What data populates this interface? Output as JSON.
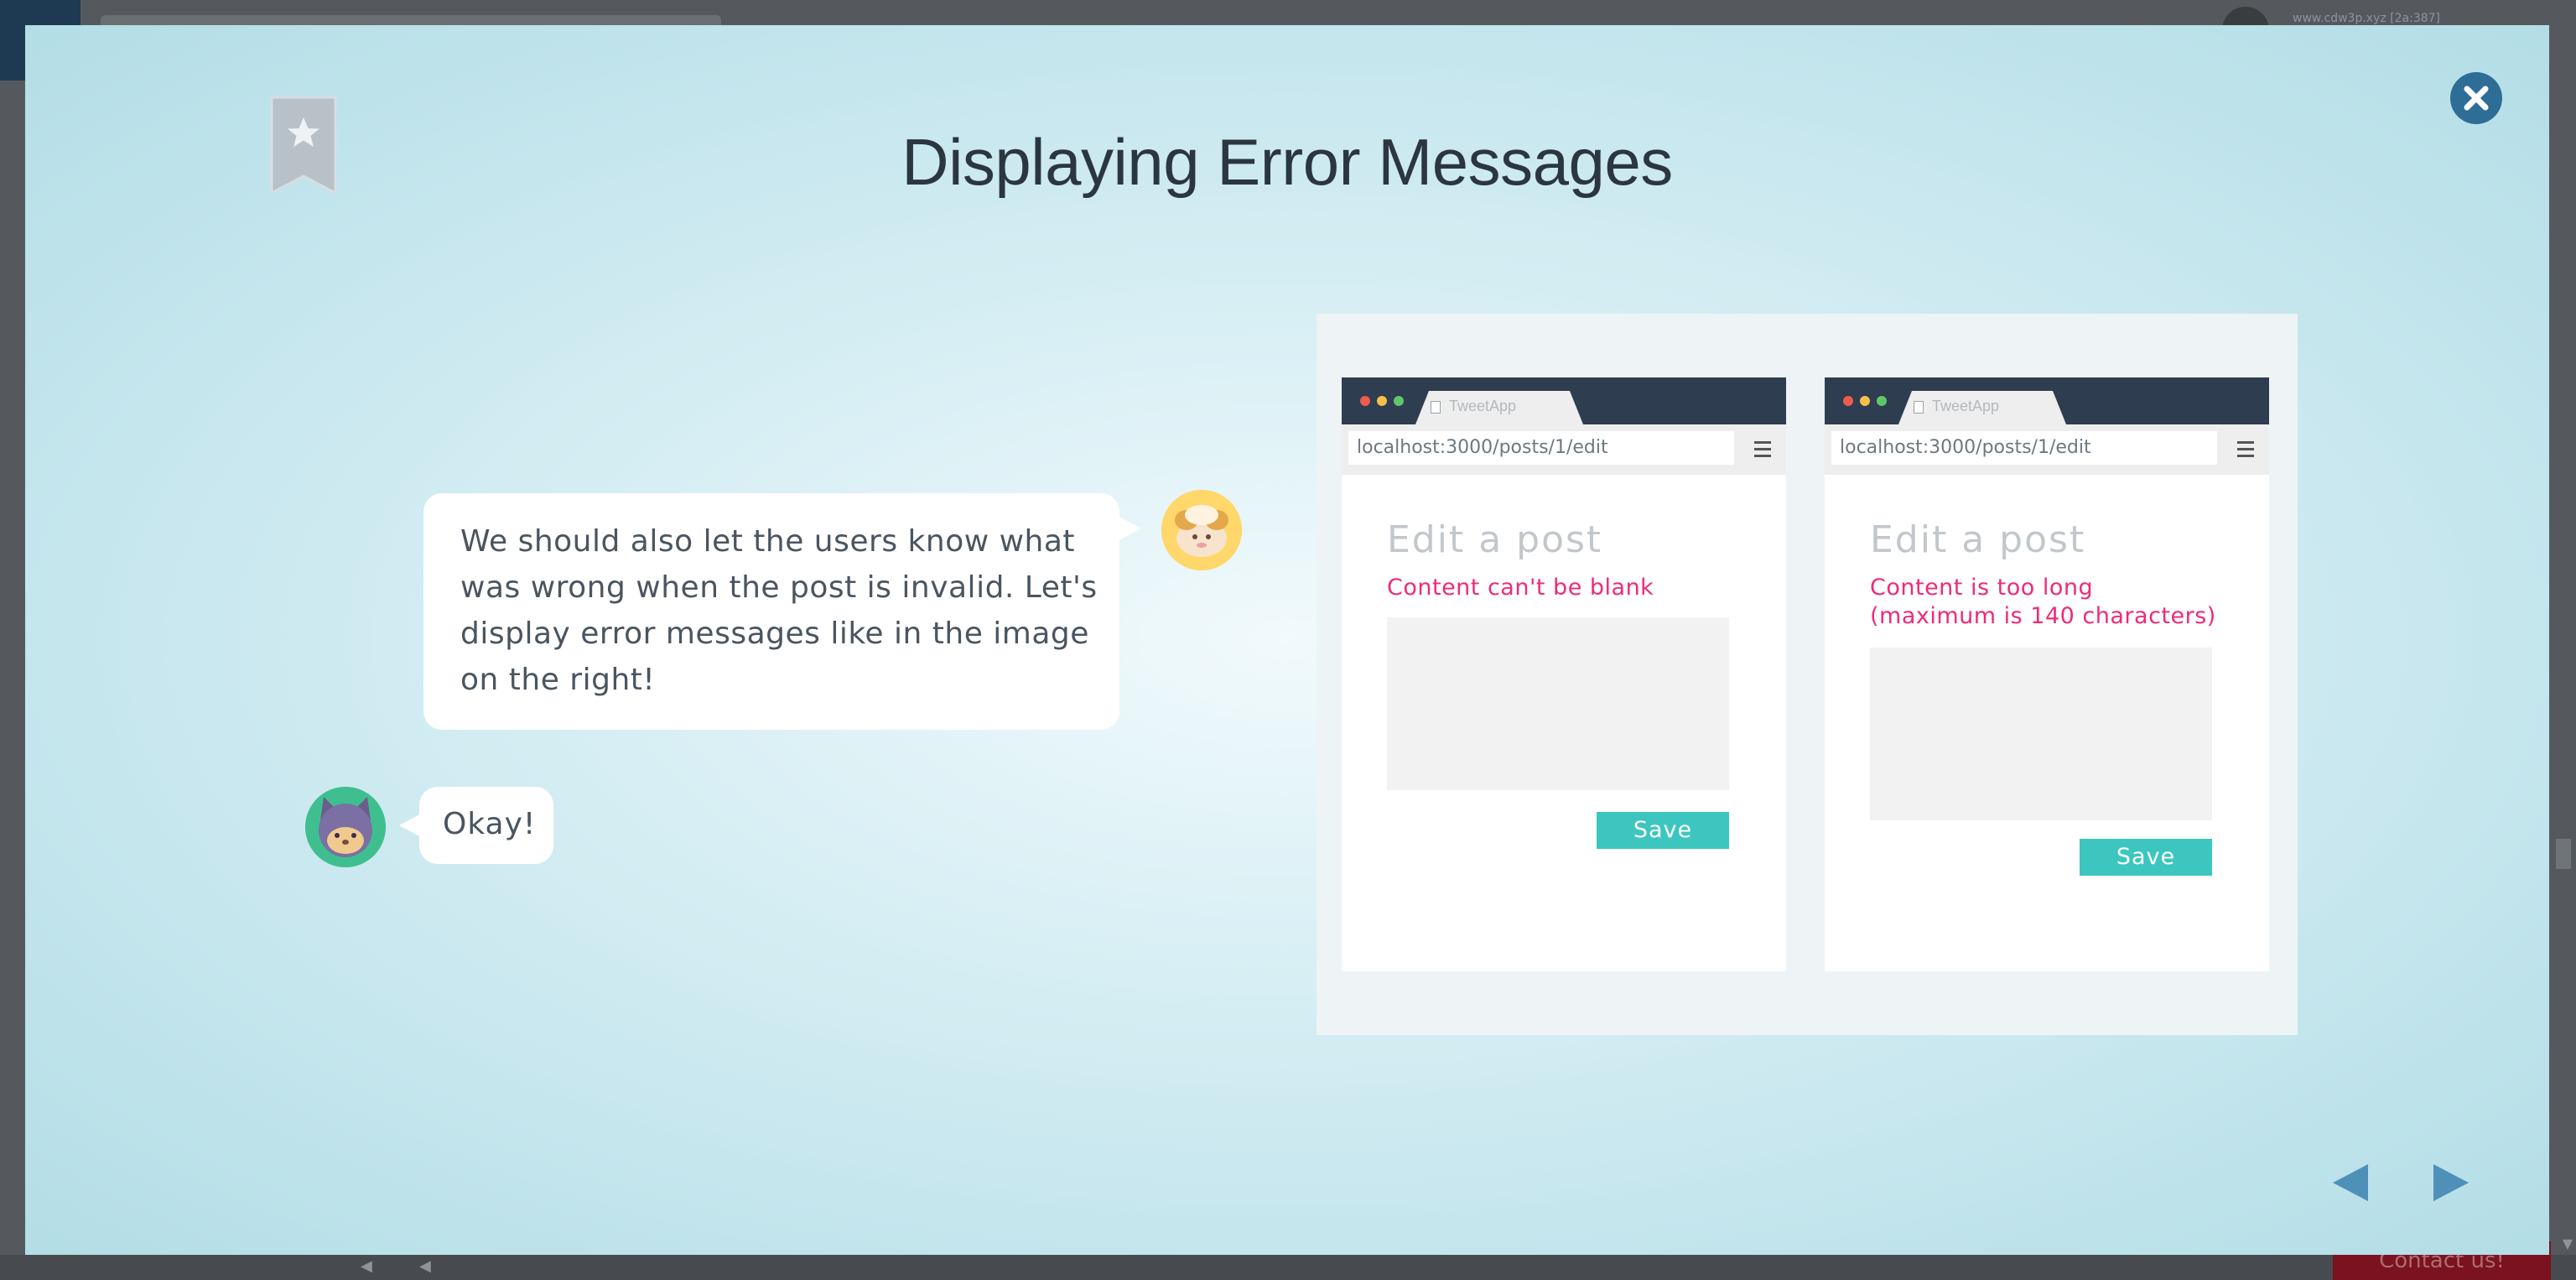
{
  "backdrop": {
    "user_text": "www.cdw3p.xyz [2a:387]",
    "contact_label": "Contact us!"
  },
  "modal": {
    "title": "Displaying Error Messages"
  },
  "dialogue": {
    "message_1": "We should also let the users know what was wrong when the post is invalid. Let's display error messages like in the image on the right!",
    "message_2": "Okay!"
  },
  "illustration": {
    "left_browser": {
      "tab_label": "TweetApp",
      "address": "localhost:3000/posts/1/edit",
      "heading": "Edit a post",
      "error": "Content can't be blank",
      "save_label": "Save"
    },
    "right_browser": {
      "tab_label": "TweetApp",
      "address": "localhost:3000/posts/1/edit",
      "heading": "Edit a post",
      "error_line_1": "Content is too long",
      "error_line_2": "(maximum is 140 characters)",
      "save_label": "Save"
    }
  },
  "colors": {
    "accent_teal": "#3cc6bf",
    "error_pink": "#ef2a7a",
    "close_blue": "#2d6d96",
    "nav_arrow": "#4f90b8"
  },
  "icons": {
    "bookmark": "bookmark-star-icon",
    "close": "close-icon",
    "prev": "prev-arrow-icon",
    "next": "next-arrow-icon"
  }
}
